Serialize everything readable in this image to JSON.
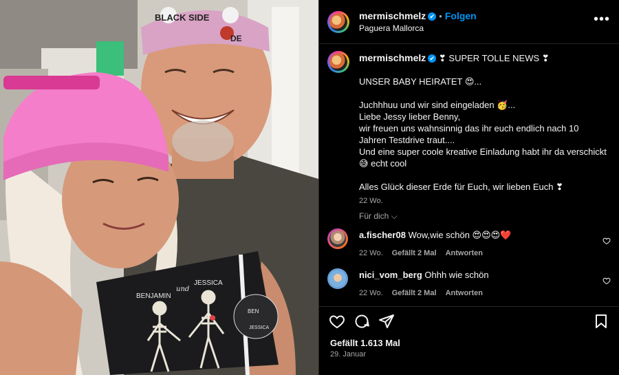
{
  "post": {
    "username": "mermischmelz",
    "verified_badge": "✔",
    "separator": "•",
    "follow_label": "Folgen",
    "location": "Paguera Mallorca",
    "more_label": "•••"
  },
  "photo": {
    "bandana_text_left": "BLACK SIDE",
    "bandana_text_right": "DE",
    "card_name_left": "BENJAMIN",
    "card_name_mid": "und",
    "card_name_right": "JESSICA",
    "tag_text_top": "BEN",
    "tag_text_bottom": "JESSICA"
  },
  "caption": {
    "username": "mermischmelz",
    "headline": "❣ SUPER TOLLE NEWS ❣",
    "line1": "UNSER BABY HEIRATET 😍...",
    "line2": "Juchhhuu und wir sind eingeladen 🥳...",
    "line3": "Liebe Jessy lieber Benny,",
    "line4": "wir freuen uns wahnsinnig das ihr euch endlich nach 10 Jahren Testdrive traut....",
    "line5": "Und eine super coole kreative Einladung habt ihr da verschickt 😅 echt cool",
    "line6": "Alles Glück dieser Erde für Euch, wir lieben Euch ❣",
    "time": "22 Wo."
  },
  "for_you_label": "Für dich ⌵",
  "comments": [
    {
      "username": "a.fischer08",
      "text": "Wow,wie schön 😍😍😍❤️",
      "time": "22 Wo.",
      "likes": "Gefällt 2 Mal",
      "reply": "Antworten"
    },
    {
      "username": "nici_vom_berg",
      "text": "Ohhh wie schön",
      "time": "22 Wo.",
      "likes": "Gefällt 2 Mal",
      "reply": "Antworten"
    }
  ],
  "footer": {
    "likes": "Gefällt 1.613 Mal",
    "date": "29. Januar"
  },
  "icons": [
    "heart-icon",
    "comment-icon",
    "share-icon",
    "bookmark-icon",
    "more-icon"
  ],
  "colors": {
    "accent": "#0095f6",
    "background": "#000000",
    "muted": "#a8a8a8"
  }
}
